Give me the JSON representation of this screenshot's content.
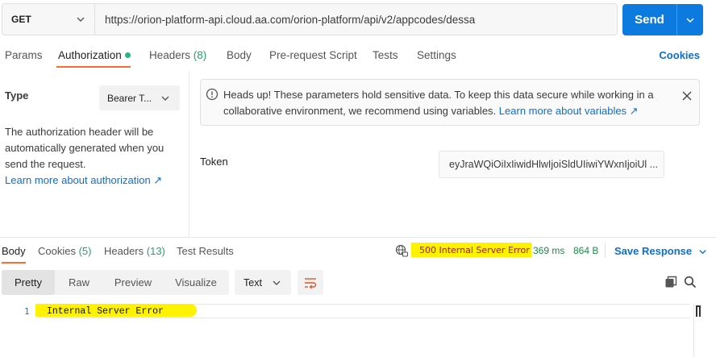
{
  "request": {
    "method": "GET",
    "url": "https://orion-platform-api.cloud.aa.com/orion-platform/api/v2/appcodes/dessa",
    "send_label": "Send"
  },
  "request_tabs": [
    {
      "label": "Params"
    },
    {
      "label": "Authorization"
    },
    {
      "label": "Headers",
      "count": "(8)"
    },
    {
      "label": "Body"
    },
    {
      "label": "Pre-request Script"
    },
    {
      "label": "Tests"
    },
    {
      "label": "Settings"
    }
  ],
  "cookies_link": "Cookies",
  "auth": {
    "type_label": "Type",
    "type_value": "Bearer T...",
    "description": "The authorization header will be automatically generated when you send the request.",
    "learn_link": "Learn more about authorization ↗"
  },
  "notice": {
    "text": "Heads up! These parameters hold sensitive data. To keep this data secure while working in a collaborative environment, we recommend using variables.",
    "link": "Learn more about variables ↗"
  },
  "token": {
    "label": "Token",
    "value": "eyJraWQiOiIxIiwidHlwIjoiSldUIiwiYWxnIjoiUl ..."
  },
  "response_tabs": [
    {
      "label": "Body"
    },
    {
      "label": "Cookies",
      "count": "(5)"
    },
    {
      "label": "Headers",
      "count": "(13)"
    },
    {
      "label": "Test Results"
    }
  ],
  "response_status": {
    "status": "500 Internal Server Error",
    "time": "369 ms",
    "size": "864 B",
    "save_label": "Save Response"
  },
  "view_modes": [
    "Pretty",
    "Raw",
    "Preview",
    "Visualize"
  ],
  "format_select": "Text",
  "response_body": {
    "line_number": "1",
    "line_text": "Internal Server Error"
  },
  "colors": {
    "accent": "#ff6c37",
    "send": "#0d7ae0",
    "link": "#0d6ed1",
    "highlight": "#fff200",
    "success": "#26b47f"
  }
}
